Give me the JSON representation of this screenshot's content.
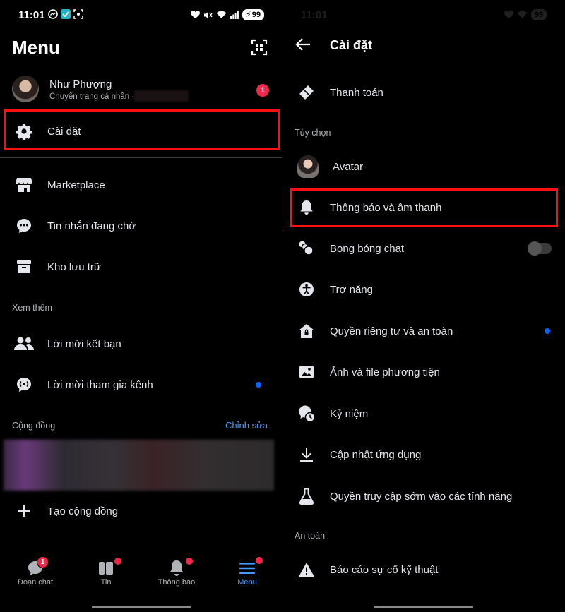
{
  "status": {
    "time": "11:01",
    "battery": "99"
  },
  "left": {
    "title": "Menu",
    "profile": {
      "name": "Như Phượng",
      "sub": "Chuyển trang cá nhân ·",
      "badge": "1"
    },
    "settings_label": "Cài đặt",
    "items": [
      {
        "label": "Marketplace"
      },
      {
        "label": "Tin nhắn đang chờ"
      },
      {
        "label": "Kho lưu trữ"
      }
    ],
    "see_more": "Xem thêm",
    "more_items": [
      {
        "label": "Lời mời kết bạn"
      },
      {
        "label": "Lời mời tham gia kênh"
      }
    ],
    "community": {
      "title": "Cộng đồng",
      "edit": "Chỉnh sửa"
    },
    "create_community": "Tạo cộng đồng",
    "nav": [
      {
        "label": "Đoạn chat",
        "badge": "1"
      },
      {
        "label": "Tin"
      },
      {
        "label": "Thông báo"
      },
      {
        "label": "Menu"
      }
    ]
  },
  "right": {
    "title": "Cài đặt",
    "payment": "Thanh toán",
    "section_options": "Tùy chọn",
    "items": [
      {
        "label": "Avatar"
      },
      {
        "label": "Thông báo và âm thanh"
      },
      {
        "label": "Bong bóng chat"
      },
      {
        "label": "Trợ năng"
      },
      {
        "label": "Quyền riêng tư và an toàn"
      },
      {
        "label": "Ảnh và file phương tiện"
      },
      {
        "label": "Kỷ niệm"
      },
      {
        "label": "Cập nhật ứng dụng"
      },
      {
        "label": "Quyền truy cập sớm vào các tính năng"
      }
    ],
    "section_safety": "An toàn",
    "report": "Báo cáo sự cố kỹ thuật"
  },
  "colors": {
    "accent": "#0866ff",
    "highlight": "#ff1010",
    "badge": "#f02849"
  }
}
